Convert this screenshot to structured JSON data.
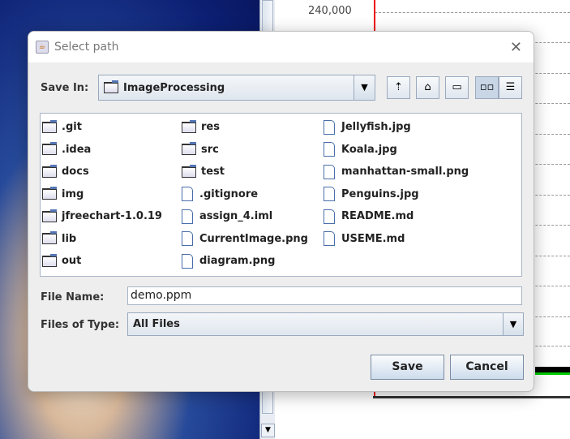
{
  "background": {
    "chart_tick": "240,000"
  },
  "dialog": {
    "title": "Select path",
    "save_in_label": "Save In:",
    "save_in_value": "ImageProcessing",
    "files": [
      [
        {
          "name": ".git",
          "type": "folder"
        },
        {
          "name": ".idea",
          "type": "folder"
        },
        {
          "name": "docs",
          "type": "folder"
        },
        {
          "name": "img",
          "type": "folder"
        },
        {
          "name": "jfreechart-1.0.19",
          "type": "folder"
        },
        {
          "name": "lib",
          "type": "folder"
        },
        {
          "name": "out",
          "type": "folder"
        }
      ],
      [
        {
          "name": "res",
          "type": "folder"
        },
        {
          "name": "src",
          "type": "folder"
        },
        {
          "name": "test",
          "type": "folder"
        },
        {
          "name": ".gitignore",
          "type": "file"
        },
        {
          "name": "assign_4.iml",
          "type": "file"
        },
        {
          "name": "CurrentImage.png",
          "type": "file"
        },
        {
          "name": "diagram.png",
          "type": "file"
        }
      ],
      [
        {
          "name": "Jellyfish.jpg",
          "type": "file"
        },
        {
          "name": "Koala.jpg",
          "type": "file"
        },
        {
          "name": "manhattan-small.png",
          "type": "file"
        },
        {
          "name": "Penguins.jpg",
          "type": "file"
        },
        {
          "name": "README.md",
          "type": "file"
        },
        {
          "name": "USEME.md",
          "type": "file"
        }
      ]
    ],
    "file_name_label": "File Name:",
    "file_name_value": "demo.ppm",
    "file_type_label": "Files of Type:",
    "file_type_value": "All Files",
    "save_label": "Save",
    "cancel_label": "Cancel"
  }
}
